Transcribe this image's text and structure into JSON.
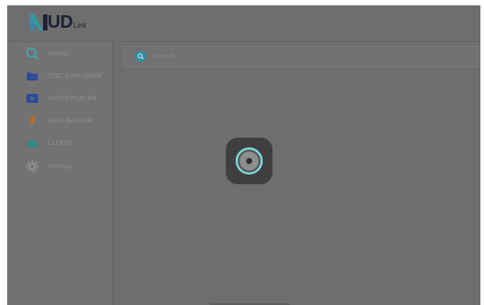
{
  "app": {
    "logo_main": "UD",
    "logo_sub": "Link"
  },
  "sidebar": {
    "items": [
      {
        "label": "Search",
        "icon": "search-icon"
      },
      {
        "label": "DISC EXPLORER",
        "icon": "folder-icon"
      },
      {
        "label": "AUDIO PLAYER",
        "icon": "play-icon"
      },
      {
        "label": "DATA BACKUP",
        "icon": "bolt-icon"
      },
      {
        "label": "CLOUD",
        "icon": "cloud-icon"
      },
      {
        "label": "Settings",
        "icon": "gear-icon"
      }
    ]
  },
  "main": {
    "search_placeholder": "Search"
  },
  "colors": {
    "accent_teal": "#3fa6b0",
    "folder_blue": "#2f4b9a",
    "bolt_orange": "#c06a1c",
    "cloud_teal": "#2f8a84",
    "loader_ring": "#7fe0e6"
  }
}
